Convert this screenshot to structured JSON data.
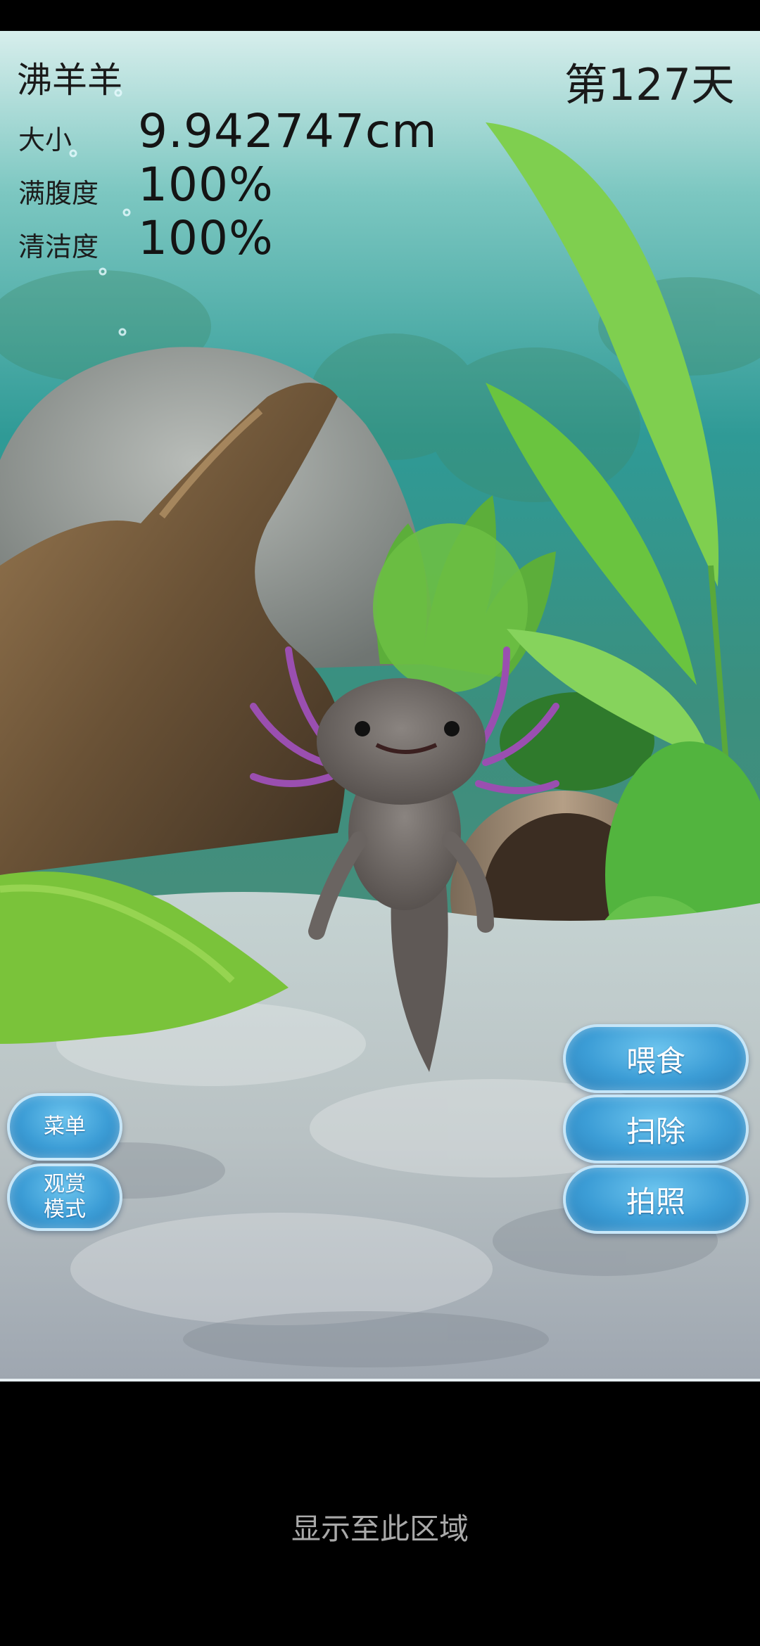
{
  "hud": {
    "pet_name": "沸羊羊",
    "day_label": "第127天",
    "stats": [
      {
        "label": "大小",
        "value": "9.942747cm"
      },
      {
        "label": "满腹度",
        "value": "100%"
      },
      {
        "label": "清洁度",
        "value": "100%"
      }
    ]
  },
  "buttons": {
    "feed": "喂食",
    "clean": "扫除",
    "photo": "拍照",
    "menu": "菜单",
    "view_mode_line1": "观赏",
    "view_mode_line2": "模式"
  },
  "footer": {
    "hint": "显示至此区域"
  },
  "colors": {
    "button_fill": "#3c9dd6",
    "water_top": "#cfe9e6",
    "water_mid": "#2f9a96",
    "gravel": "#cfd6d4",
    "axolotl_body": "#75706d",
    "gills": "#9a4fb0"
  },
  "icons": {
    "pet": "axolotl-sprite"
  }
}
